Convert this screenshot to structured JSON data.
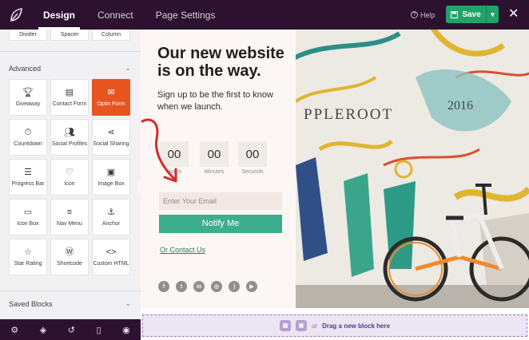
{
  "topbar": {
    "tabs": [
      {
        "label": "Design",
        "active": true
      },
      {
        "label": "Connect",
        "active": false
      },
      {
        "label": "Page Settings",
        "active": false
      }
    ],
    "help_label": "Help",
    "save_label": "Save",
    "colors": {
      "bar": "#2d1230",
      "save": "#1fa36b"
    }
  },
  "sidebar": {
    "basic_row": [
      "Divider",
      "Spacer",
      "Column"
    ],
    "advanced": {
      "title": "Advanced",
      "items": [
        {
          "label": "Giveaway",
          "icon": "trophy-icon"
        },
        {
          "label": "Contact Form",
          "icon": "contact-form-icon"
        },
        {
          "label": "Optin Form",
          "icon": "envelope-icon",
          "selected": true
        },
        {
          "label": "Countdown",
          "icon": "stopwatch-icon"
        },
        {
          "label": "Social Profiles",
          "icon": "users-icon"
        },
        {
          "label": "Social Sharing",
          "icon": "share-icon"
        },
        {
          "label": "Progress Bar",
          "icon": "progress-bar-icon"
        },
        {
          "label": "Icon",
          "icon": "heart-icon"
        },
        {
          "label": "Image Box",
          "icon": "image-box-icon"
        },
        {
          "label": "Icon Box",
          "icon": "icon-box-icon"
        },
        {
          "label": "Nav Menu",
          "icon": "menu-icon"
        },
        {
          "label": "Anchor",
          "icon": "anchor-icon"
        },
        {
          "label": "Star Rating",
          "icon": "star-icon"
        },
        {
          "label": "Shortcode",
          "icon": "wordpress-icon"
        },
        {
          "label": "Custom HTML",
          "icon": "code-icon"
        }
      ]
    },
    "saved_blocks_title": "Saved Blocks",
    "selected_color": "#e85420"
  },
  "bottom_toolbar": [
    "gear-icon",
    "layers-icon",
    "history-icon",
    "mobile-icon",
    "eye-icon"
  ],
  "page": {
    "headline": "Our new website is on the way.",
    "subtext": "Sign up to be the first to know when we launch.",
    "countdown": [
      {
        "value": "00",
        "unit": "Hours"
      },
      {
        "value": "00",
        "unit": "Minutes"
      },
      {
        "value": "00",
        "unit": "Seconds"
      }
    ],
    "email_placeholder": "Enter Your Email",
    "button_label": "Notify Me",
    "contact_link": "Or Contact Us",
    "socials": [
      "facebook-icon",
      "twitter-icon",
      "linkedin-icon",
      "instagram-icon",
      "rss-icon",
      "youtube-icon"
    ],
    "button_color": "#3dae8b"
  },
  "dropzone": {
    "or_text": "or",
    "label": "Drag a new block here"
  }
}
